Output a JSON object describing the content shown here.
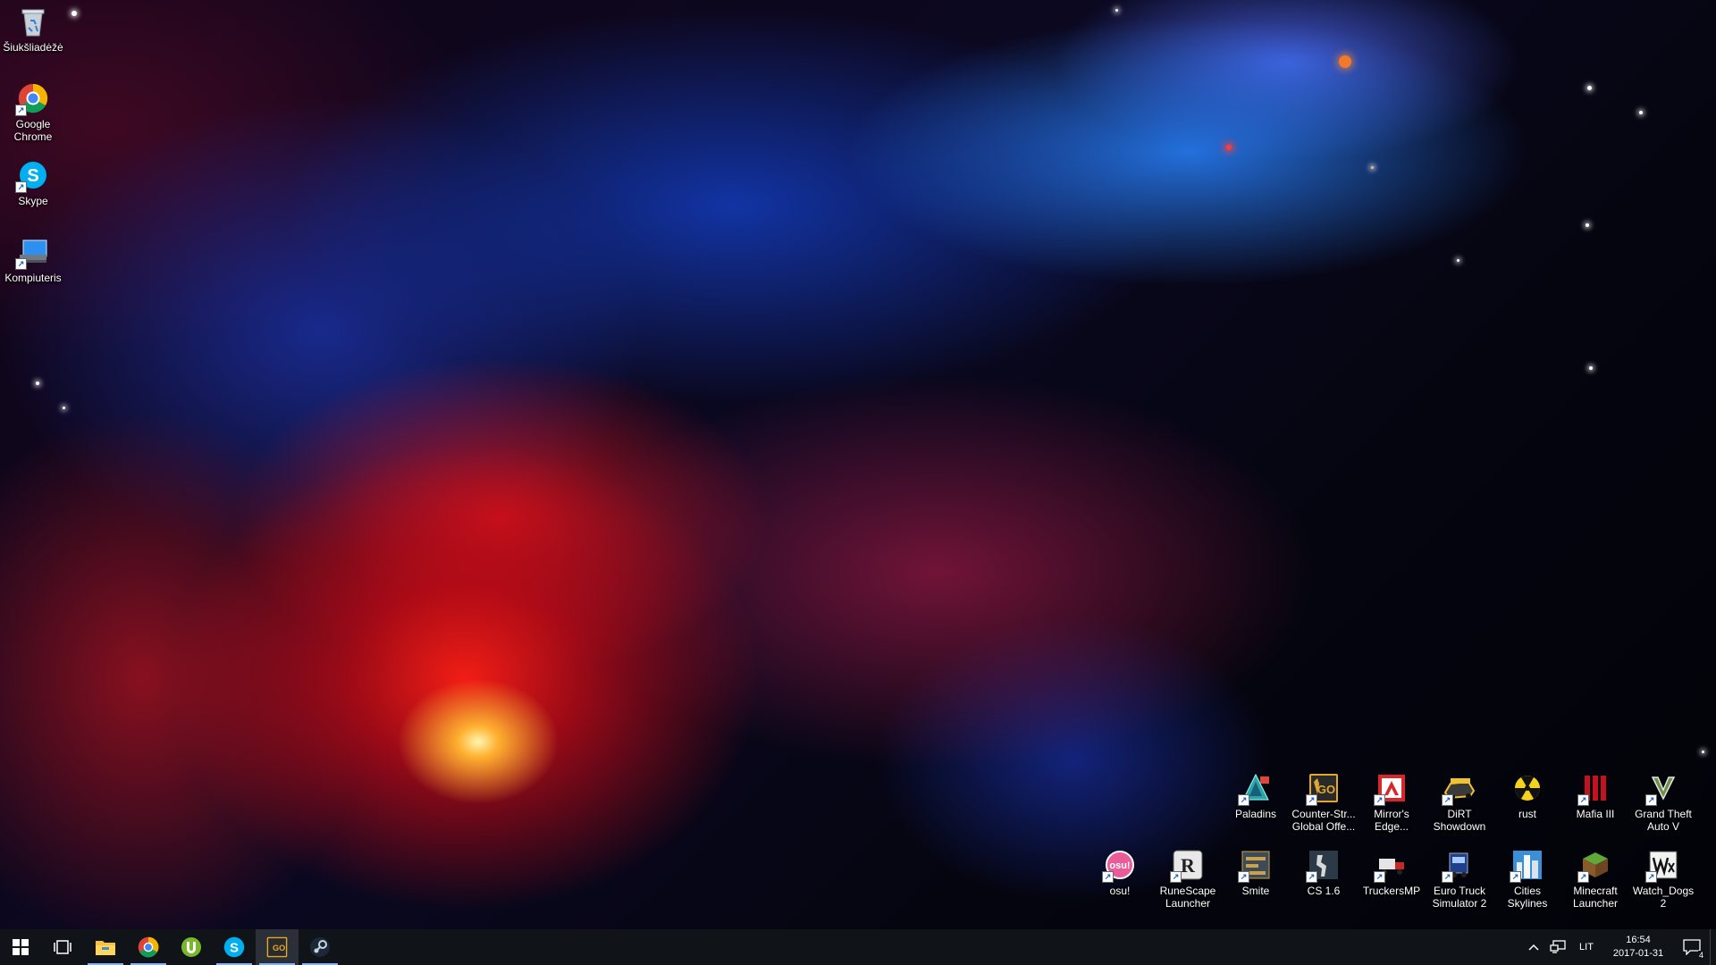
{
  "desktop_icons_left": [
    {
      "name": "recycle-bin-icon",
      "label": "Šiukšliadėžė"
    },
    {
      "name": "google-chrome-icon",
      "label": "Google\nChrome"
    },
    {
      "name": "skype-icon",
      "label": "Skype"
    },
    {
      "name": "computer-icon",
      "label": "Kompiuteris"
    }
  ],
  "desktop_icons_right_row1": [
    {
      "name": "paladins-icon",
      "label": "Paladins"
    },
    {
      "name": "counter-strike-go-icon",
      "label": "Counter-Str...\nGlobal Offe..."
    },
    {
      "name": "mirrors-edge-icon",
      "label": "Mirror's\nEdge..."
    },
    {
      "name": "dirt-showdown-icon",
      "label": "DiRT\nShowdown"
    },
    {
      "name": "rust-icon",
      "label": "rust"
    },
    {
      "name": "mafia-iii-icon",
      "label": "Mafia III"
    },
    {
      "name": "gta-v-icon",
      "label": "Grand Theft\nAuto V"
    }
  ],
  "desktop_icons_right_row2": [
    {
      "name": "osu-icon",
      "label": "osu!"
    },
    {
      "name": "runescape-launcher-icon",
      "label": "RuneScape\nLauncher"
    },
    {
      "name": "smite-icon",
      "label": "Smite"
    },
    {
      "name": "cs16-icon",
      "label": "CS 1.6"
    },
    {
      "name": "truckersmp-icon",
      "label": "TruckersMP"
    },
    {
      "name": "euro-truck-simulator-icon",
      "label": "Euro Truck\nSimulator 2"
    },
    {
      "name": "cities-skylines-icon",
      "label": "Cities\nSkylines"
    },
    {
      "name": "minecraft-launcher-icon",
      "label": "Minecraft\nLauncher"
    },
    {
      "name": "watch-dogs-2-icon",
      "label": "Watch_Dogs\n2"
    }
  ],
  "taskbar": {
    "pinned": [
      {
        "name": "file-explorer-icon"
      },
      {
        "name": "chrome-taskbar-icon"
      },
      {
        "name": "utorrent-icon"
      },
      {
        "name": "skype-taskbar-icon"
      },
      {
        "name": "csgo-taskbar-icon"
      },
      {
        "name": "steam-icon"
      }
    ],
    "tray": {
      "language": "LIT",
      "time": "16:54",
      "date": "2017-01-31",
      "notification_count": "4"
    }
  },
  "colors": {
    "taskbar_bg": "#101318",
    "active_indicator": "#7fb3ff"
  }
}
